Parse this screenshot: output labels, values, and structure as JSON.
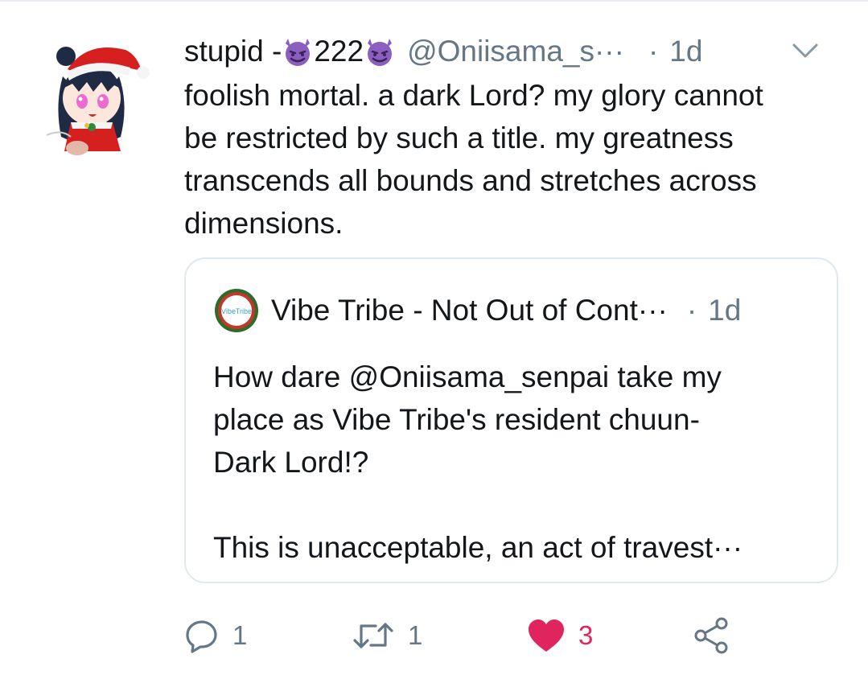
{
  "tweet": {
    "display_name_prefix": "stupid - ",
    "display_name_number": "222",
    "handle": "@Oniisama_s···",
    "separator": "·",
    "time": "1d",
    "text": "foolish mortal. a dark Lord? my glory cannot\nbe restricted by such a title. my greatness\ntranscends all bounds and stretches across\ndimensions.",
    "avatar_icon": "anime-santa-avatar",
    "emoji_icon": "smiling-imp-emoji",
    "emoji_color": "#8b5fbf"
  },
  "quote": {
    "name": "Vibe Tribe - Not Out of Cont···",
    "separator": "·",
    "time": "1d",
    "avatar_text": "VibeTribe",
    "text": "How dare @Oniisama_senpai take my\nplace as Vibe Tribe's resident chuun-\nDark Lord!?\n\nThis is unacceptable, an act of travest···"
  },
  "actions": {
    "reply_count": "1",
    "retweet_count": "1",
    "like_count": "3",
    "like_color": "#e0245e",
    "icon_color": "#657786"
  }
}
